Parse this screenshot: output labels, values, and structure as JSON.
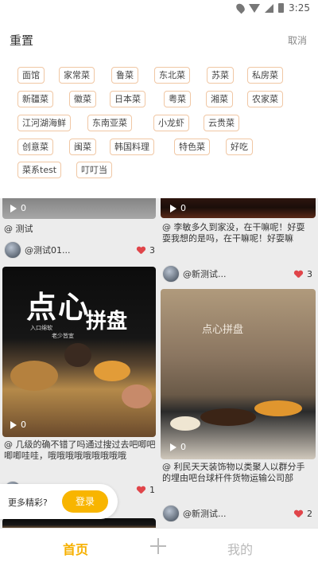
{
  "status_bar": {
    "time": "3:25"
  },
  "filter": {
    "title": "重置",
    "cancel": "取消",
    "tags": [
      "面馆",
      "家常菜",
      "鲁菜",
      "东北菜",
      "苏菜",
      "私房菜",
      "新疆菜",
      "徽菜",
      "日本菜",
      "粤菜",
      "湘菜",
      "农家菜",
      "江河湖海鲜",
      "东南亚菜",
      "小龙虾",
      "云贵菜",
      "创意菜",
      "闽菜",
      "韩国料理",
      "特色菜",
      "好吃",
      "菜系test",
      "叮叮当"
    ]
  },
  "feed": {
    "cards": [
      {
        "play_count": "0",
        "description": "@ 测试",
        "user": "@测试01...",
        "likes": "3"
      },
      {
        "play_count": "0",
        "description": "@ 李敏多久到家没，在干嘛呢！好耍耍我想的是吗，在干嘛呢！好耍嘛",
        "user": "@新测试...",
        "likes": "3"
      },
      {
        "play_count": "0",
        "description": "@ 几级的确不错了吗通过搜过去吧唧吧唧唧哇哇，哦哦哦哦哦哦哦哦哦",
        "user": "@...",
        "likes": "1",
        "image_title": "点心",
        "image_title_2": "拼盘",
        "image_sub_1": "入口绵软",
        "image_sub_2": "老少皆宜"
      },
      {
        "play_count": "0",
        "description": "@ 利民天天装饰物以类聚人以群分手的埋由吧台球杆件货物运输公司部",
        "user": "@新测试...",
        "likes": "2",
        "image_title": "点心拼盘"
      }
    ]
  },
  "login_prompt": {
    "text": "更多精彩?",
    "button": "登录"
  },
  "tabbar": {
    "home": "首页",
    "mine": "我的"
  }
}
